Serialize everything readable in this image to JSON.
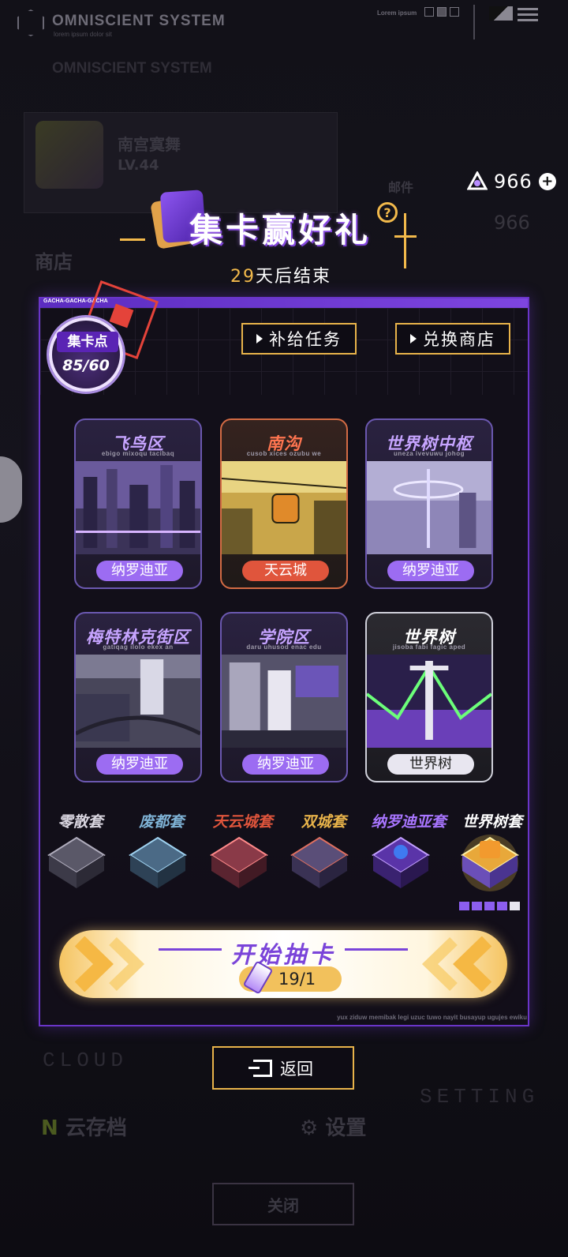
{
  "system": {
    "title": "OMNISCIENT SYSTEM",
    "subtitle": "lorem ipsum dolor sit",
    "corner_text": "Lorem ipsum"
  },
  "currency": {
    "value": "966",
    "plus": "+"
  },
  "background": {
    "shop_label": "商店",
    "mail_label": "邮件",
    "profile_name": "南宫寞舞",
    "profile_level": "LV.44",
    "cloud_en": "CLOUD",
    "cloud_label": "云存档",
    "setting_en": "SETTING",
    "setting_label": "设置",
    "close_label": "关闭"
  },
  "headline": {
    "title": "集卡赢好礼",
    "help": "?",
    "days": "29",
    "days_suffix": "天后结束"
  },
  "panel": {
    "header_tag": "GACHA-GACHA-GACHA",
    "points_label": "集卡点",
    "points_value": "85/60",
    "supply_button": "补给任务",
    "shop_button": "兑换商店",
    "footer_text": "yux ziduw memibak legi uzuc tuwo nayit busayup ugujes ewiku"
  },
  "cards": [
    {
      "title": "飞鸟区",
      "subtitle": "ebigo mixoqu tacibaq",
      "tag": "纳罗迪亚",
      "theme": "purple"
    },
    {
      "title": "南沟",
      "subtitle": "cusob xices ozubu we",
      "tag": "天云城",
      "theme": "orange"
    },
    {
      "title": "世界树中枢",
      "subtitle": "uneza ivevuwu johog",
      "tag": "纳罗迪亚",
      "theme": "purple"
    },
    {
      "title": "梅特林克街区",
      "subtitle": "gatiqag ilolo ekex an",
      "tag": "纳罗迪亚",
      "theme": "purple"
    },
    {
      "title": "学院区",
      "subtitle": "daru uhusod enac edu",
      "tag": "纳罗迪亚",
      "theme": "purple"
    },
    {
      "title": "世界树",
      "subtitle": "jisoba fabi fagic aped",
      "tag": "世界树",
      "theme": "white"
    }
  ],
  "sets": [
    {
      "name": "零散套",
      "color": "#d9d6e0"
    },
    {
      "name": "废都套",
      "color": "#7fb3d6"
    },
    {
      "name": "天云城套",
      "color": "#e0553c"
    },
    {
      "name": "双城套",
      "color": "#e8b34a"
    },
    {
      "name": "纳罗迪亚套",
      "color": "#a875ff"
    },
    {
      "name": "世界树套",
      "color": "#ffffff"
    }
  ],
  "progress_dots": {
    "filled": 4,
    "total": 5
  },
  "draw": {
    "title": "开始抽卡",
    "count": "19/1"
  },
  "back_button": "返回",
  "colors": {
    "accent_purple": "#6a35c8",
    "accent_gold": "#e8b34a",
    "accent_red": "#e4433a"
  }
}
